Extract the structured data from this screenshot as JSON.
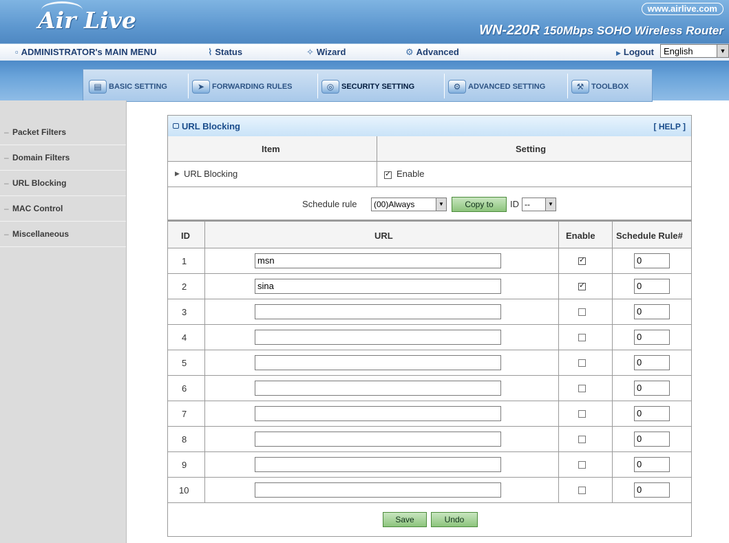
{
  "header": {
    "logo": "Air Live",
    "site_url": "www.airlive.com",
    "model": "WN-220R",
    "model_desc": "150Mbps SOHO Wireless Router"
  },
  "menubar": {
    "main_menu": "ADMINISTRATOR's MAIN MENU",
    "status": "Status",
    "wizard": "Wizard",
    "advanced": "Advanced",
    "logout": "Logout",
    "language": "English"
  },
  "tabs": {
    "basic": "BASIC SETTING",
    "forwarding": "FORWARDING RULES",
    "security": "SECURITY SETTING",
    "advanced": "ADVANCED SETTING",
    "toolbox": "TOOLBOX"
  },
  "sidebar": {
    "items": [
      {
        "label": "Packet Filters"
      },
      {
        "label": "Domain Filters"
      },
      {
        "label": "URL Blocking"
      },
      {
        "label": "MAC Control"
      },
      {
        "label": "Miscellaneous"
      }
    ]
  },
  "panel": {
    "title": "URL Blocking",
    "help": "[ HELP ]",
    "col_item": "Item",
    "col_setting": "Setting",
    "row_label": "URL Blocking",
    "enable_label": "Enable",
    "schedule_label": "Schedule rule",
    "schedule_value": "(00)Always",
    "copy_to": "Copy to",
    "id_label": "ID",
    "id_value": "--",
    "table_headers": {
      "id": "ID",
      "url": "URL",
      "enable": "Enable",
      "rule": "Schedule Rule#"
    },
    "rows": [
      {
        "id": "1",
        "url": "msn",
        "enabled": true,
        "rule": "0"
      },
      {
        "id": "2",
        "url": "sina",
        "enabled": true,
        "rule": "0"
      },
      {
        "id": "3",
        "url": "",
        "enabled": false,
        "rule": "0"
      },
      {
        "id": "4",
        "url": "",
        "enabled": false,
        "rule": "0"
      },
      {
        "id": "5",
        "url": "",
        "enabled": false,
        "rule": "0"
      },
      {
        "id": "6",
        "url": "",
        "enabled": false,
        "rule": "0"
      },
      {
        "id": "7",
        "url": "",
        "enabled": false,
        "rule": "0"
      },
      {
        "id": "8",
        "url": "",
        "enabled": false,
        "rule": "0"
      },
      {
        "id": "9",
        "url": "",
        "enabled": false,
        "rule": "0"
      },
      {
        "id": "10",
        "url": "",
        "enabled": false,
        "rule": "0"
      }
    ],
    "save": "Save",
    "undo": "Undo"
  }
}
